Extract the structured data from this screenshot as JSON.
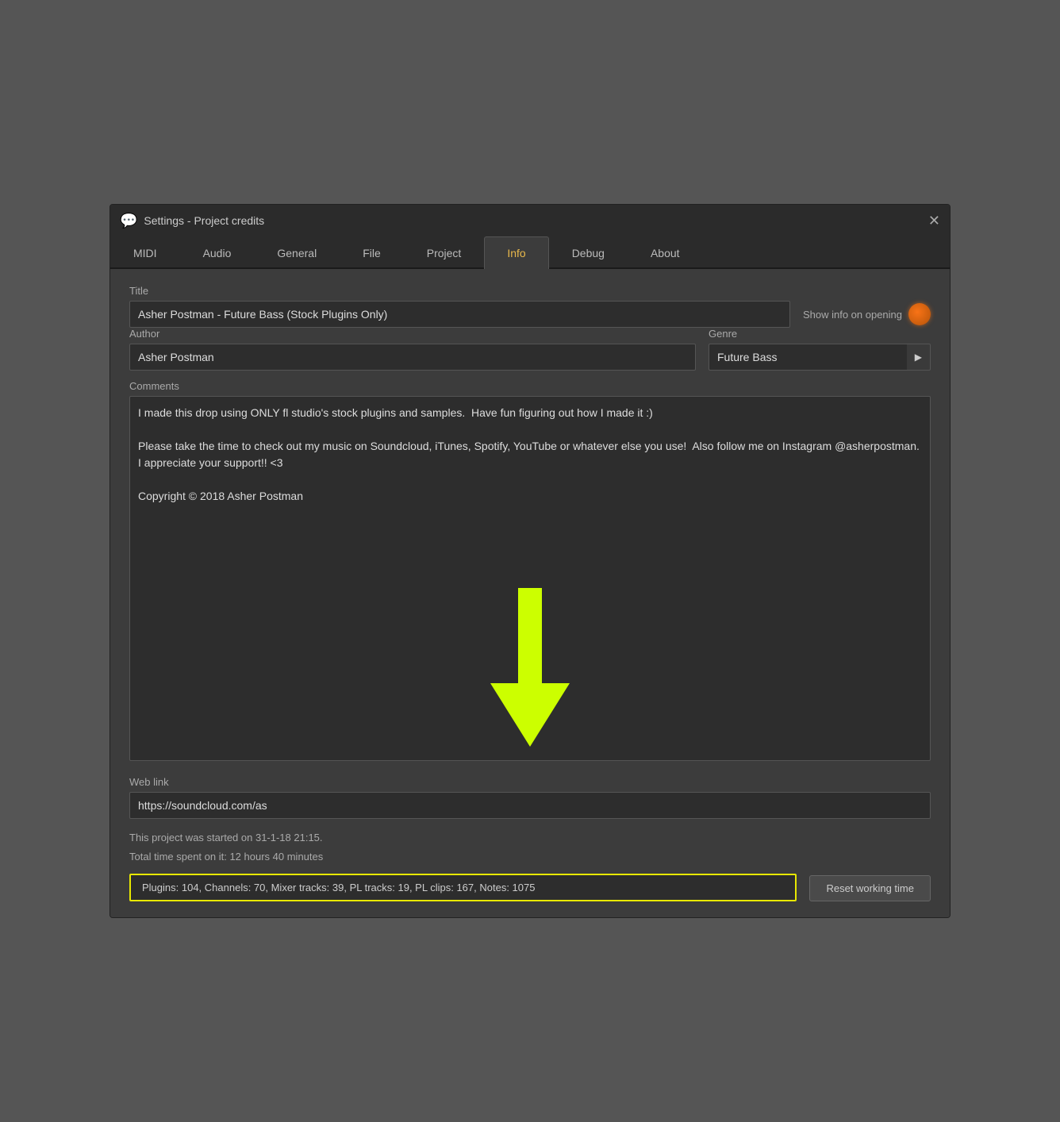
{
  "window": {
    "title": "Settings - Project credits",
    "icon": "💬"
  },
  "tabs": [
    {
      "id": "midi",
      "label": "MIDI",
      "active": false
    },
    {
      "id": "audio",
      "label": "Audio",
      "active": false
    },
    {
      "id": "general",
      "label": "General",
      "active": false
    },
    {
      "id": "file",
      "label": "File",
      "active": false
    },
    {
      "id": "project",
      "label": "Project",
      "active": false
    },
    {
      "id": "info",
      "label": "Info",
      "active": true
    },
    {
      "id": "debug",
      "label": "Debug",
      "active": false
    },
    {
      "id": "about",
      "label": "About",
      "active": false
    }
  ],
  "fields": {
    "title_label": "Title",
    "title_value": "Asher Postman - Future Bass (Stock Plugins Only)",
    "show_info_label": "Show info on opening",
    "author_label": "Author",
    "author_value": "Asher Postman",
    "genre_label": "Genre",
    "genre_value": "Future Bass",
    "comments_label": "Comments",
    "comments_value": "I made this drop using ONLY fl studio's stock plugins and samples.  Have fun figuring out how I made it :)\n\nPlease take the time to check out my music on Soundcloud, iTunes, Spotify, YouTube or whatever else you use!  Also follow me on Instagram @asherpostman.  I appreciate your support!! <3\n\nCopyright © 2018 Asher Postman",
    "weblink_label": "Web link",
    "weblink_value": "https://soundcloud.com/as",
    "project_start": "This project was started on 31-1-18 21:15.",
    "time_spent": "Total time spent on it: 12 hours 40 minutes",
    "stats": "Plugins: 104, Channels: 70, Mixer tracks: 39, PL tracks: 19, PL clips: 167, Notes: 1075",
    "reset_btn_label": "Reset working time"
  },
  "close_button": "✕"
}
